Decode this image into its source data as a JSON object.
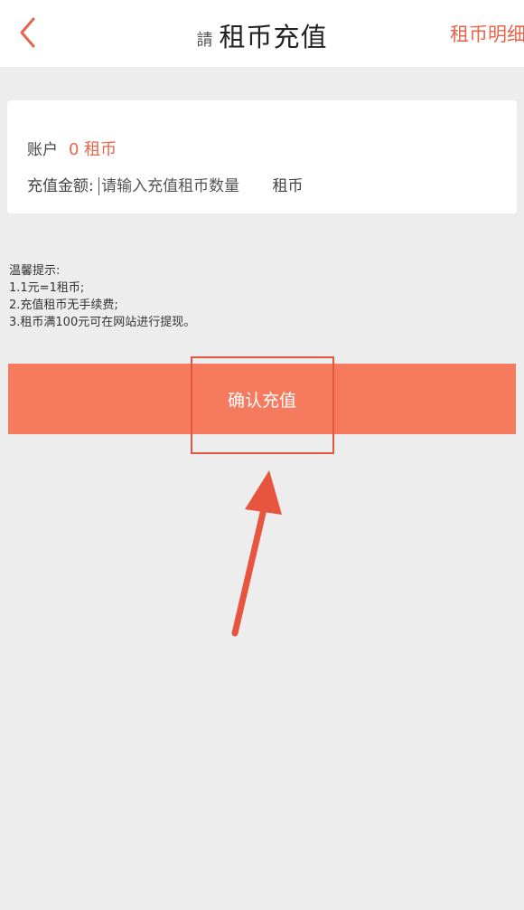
{
  "header": {
    "title": "租币充值",
    "title_prefix": "請",
    "right_link": "租币明细",
    "back_icon": "chevron-left-icon"
  },
  "account": {
    "label": "账户",
    "balance": "0 租币"
  },
  "recharge": {
    "label": "充值金额:",
    "placeholder": "请输入充值租币数量",
    "unit": "租币"
  },
  "tips": {
    "title": "温馨提示:",
    "items": [
      "1.1元=1租币;",
      "2.充值租币无手续费;",
      "3.租币满100元可在网站进行提现。"
    ]
  },
  "confirm_button": "确认充值",
  "colors": {
    "accent": "#e8644a",
    "button": "#f57a5e",
    "background": "#ededed",
    "annotation": "#e8553f"
  }
}
